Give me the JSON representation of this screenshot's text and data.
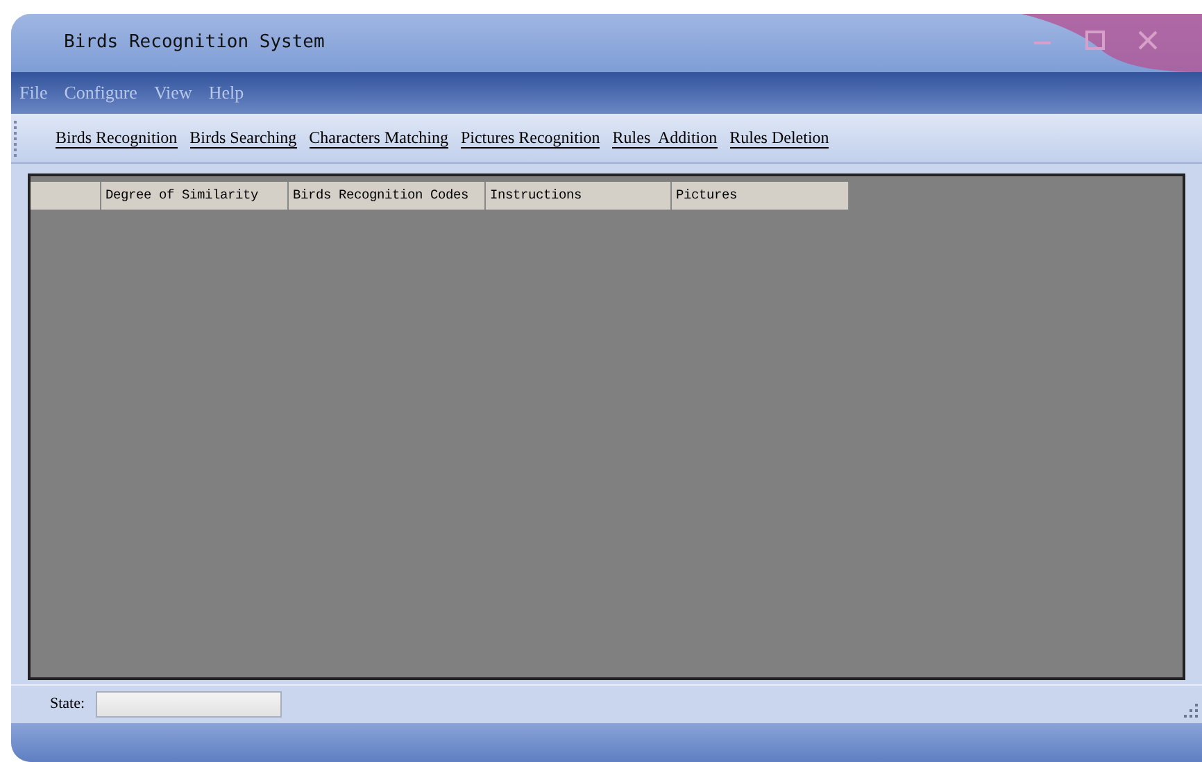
{
  "window": {
    "title": "Birds Recognition System"
  },
  "menu": [
    "File",
    "Configure",
    "View",
    "Help"
  ],
  "toolbar": [
    "Birds Recognition",
    "Birds Searching",
    "Characters Matching",
    "Pictures Recognition",
    "Rules  Addition",
    "Rules Deletion"
  ],
  "table": {
    "columns": [
      "Degree of Similarity",
      "Birds Recognition Codes",
      "Instructions",
      "Pictures"
    ]
  },
  "status_bar": {
    "label": "State:"
  }
}
